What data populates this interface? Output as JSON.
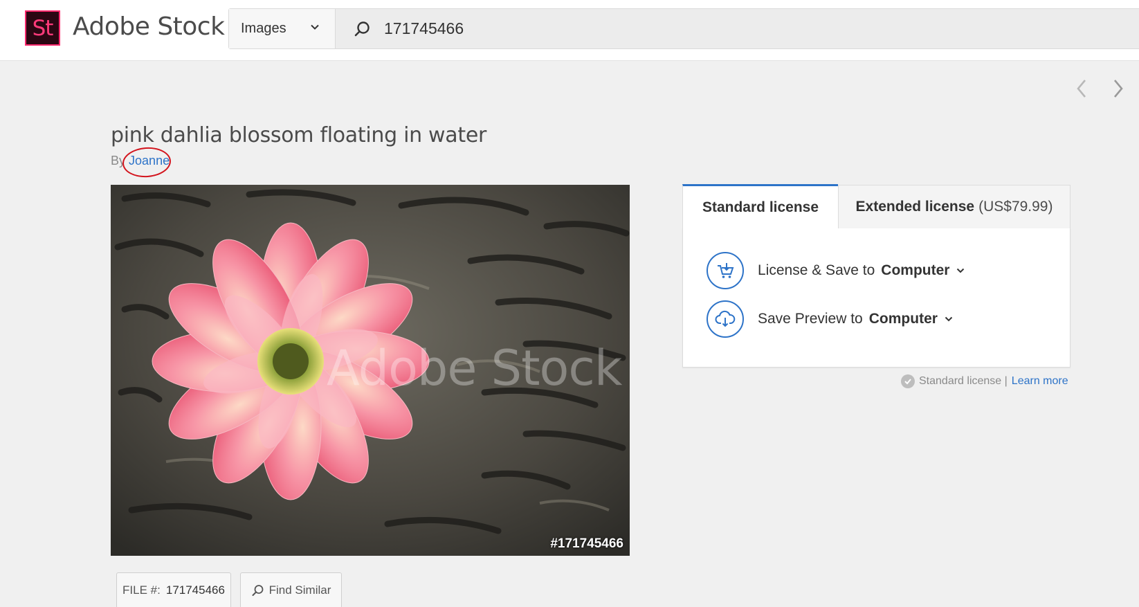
{
  "header": {
    "logo_text": "St",
    "brand": "Adobe Stock",
    "search_type": "Images",
    "search_value": "171745466"
  },
  "asset": {
    "title": "pink dahlia blossom floating in water",
    "by_label": "By",
    "author": "Joanne",
    "watermark": "Adobe Stock",
    "overlay_id": "#171745466",
    "file_label": "FILE #:",
    "file_number": "171745466",
    "find_similar": "Find Similar"
  },
  "license": {
    "tab_standard": "Standard license",
    "tab_extended": "Extended license",
    "tab_extended_price": "(US$79.99)",
    "actions": [
      {
        "label": "License & Save to",
        "destination": "Computer",
        "icon": "cart-download-icon"
      },
      {
        "label": "Save Preview to",
        "destination": "Computer",
        "icon": "cloud-download-icon"
      }
    ],
    "note": "Standard license |",
    "learn_more": "Learn more"
  },
  "colors": {
    "accent": "#2d73c8",
    "logo_bg": "#2b0713",
    "logo_fg": "#ff3a7a",
    "annotation_circle": "#d3141d"
  }
}
